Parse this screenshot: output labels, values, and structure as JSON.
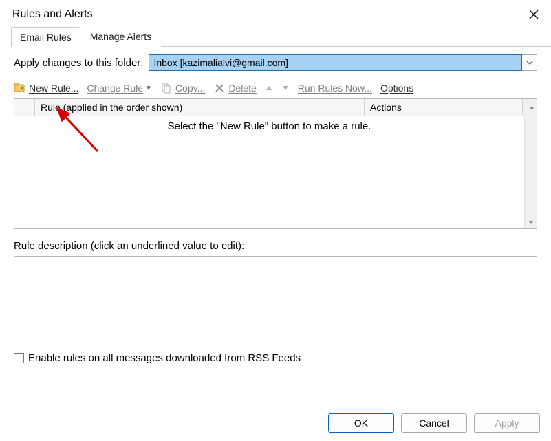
{
  "window": {
    "title": "Rules and Alerts"
  },
  "tabs": {
    "email_rules": "Email Rules",
    "manage_alerts": "Manage Alerts"
  },
  "folder": {
    "label": "Apply changes to this folder:",
    "value": "Inbox [kazimalialvi@gmail.com]"
  },
  "toolbar": {
    "new_rule": "New Rule...",
    "change_rule": "Change Rule",
    "copy": "Copy...",
    "delete": "Delete",
    "run_now": "Run Rules Now...",
    "options": "Options"
  },
  "table": {
    "col_rule": "Rule (applied in the order shown)",
    "col_actions": "Actions",
    "empty_message": "Select the \"New Rule\" button to make a rule."
  },
  "description": {
    "label": "Rule description (click an underlined value to edit):"
  },
  "rss": {
    "label": "Enable rules on all messages downloaded from RSS Feeds"
  },
  "buttons": {
    "ok": "OK",
    "cancel": "Cancel",
    "apply": "Apply"
  }
}
